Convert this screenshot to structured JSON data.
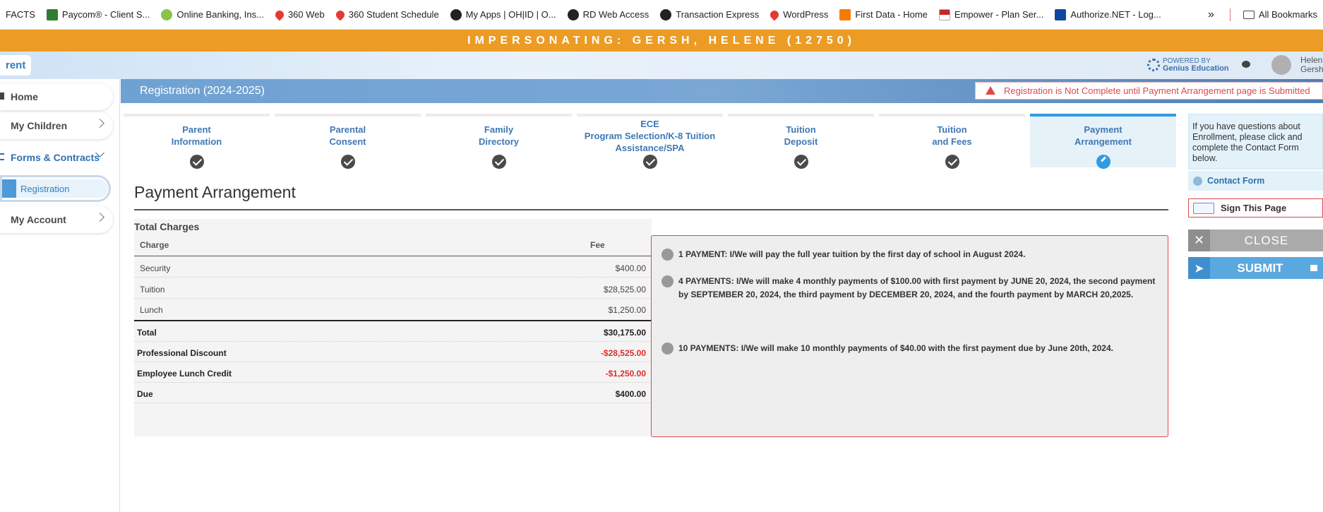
{
  "bookmarks": [
    {
      "label": "FACTS",
      "icon": "none"
    },
    {
      "label": "Paycom® - Client S...",
      "icon": "paycom-icon"
    },
    {
      "label": "Online Banking, Ins...",
      "icon": "bank-icon"
    },
    {
      "label": "360 Web",
      "icon": "drop-icon"
    },
    {
      "label": "360 Student Schedule",
      "icon": "drop-icon"
    },
    {
      "label": "My Apps | OH|ID | O...",
      "icon": "globe-icon"
    },
    {
      "label": "RD Web Access",
      "icon": "globe-icon"
    },
    {
      "label": "Transaction Express",
      "icon": "globe-icon"
    },
    {
      "label": "WordPress",
      "icon": "drop-icon"
    },
    {
      "label": "First Data - Home",
      "icon": "square-icon"
    },
    {
      "label": "Empower - Plan Ser...",
      "icon": "flag-icon"
    },
    {
      "label": "Authorize.NET - Log...",
      "icon": "authorize-icon"
    }
  ],
  "bookmarks_more": "»",
  "all_bookmarks": "All Bookmarks",
  "impersonation": "IMPERSONATING: GERSH, HELENE (12750)",
  "header": {
    "brand": "rent",
    "powered_by": "POWERED BY",
    "powered_name": "Genius Education",
    "user_first": "Helen",
    "user_last": "Gersh"
  },
  "sidebar": {
    "items": [
      {
        "label": "Home"
      },
      {
        "label": "My Children"
      },
      {
        "label": "Forms & Contracts"
      },
      {
        "label": "Registration"
      },
      {
        "label": "My Account"
      }
    ]
  },
  "registration": {
    "title": "Registration (2024-2025)",
    "warning": "Registration is Not Complete until Payment Arrangement page is Submitted"
  },
  "steps": [
    {
      "line1": "Parent",
      "line2": "Information",
      "line3": ""
    },
    {
      "line1": "Parental",
      "line2": "Consent",
      "line3": ""
    },
    {
      "line1": "Family",
      "line2": "Directory",
      "line3": ""
    },
    {
      "line1": "ECE",
      "line2": "Program Selection/K-8 Tuition",
      "line3": "Assistance/SPA"
    },
    {
      "line1": "Tuition",
      "line2": "Deposit",
      "line3": ""
    },
    {
      "line1": "Tuition",
      "line2": "and Fees",
      "line3": ""
    },
    {
      "line1": "Payment",
      "line2": "Arrangement",
      "line3": ""
    }
  ],
  "page": {
    "title": "Payment Arrangement",
    "section": "Total Charges",
    "col_charge": "Charge",
    "col_fee": "Fee"
  },
  "charges": [
    {
      "charge": "Security",
      "fee": "$400.00"
    },
    {
      "charge": "Tuition",
      "fee": "$28,525.00"
    },
    {
      "charge": "Lunch",
      "fee": "$1,250.00"
    }
  ],
  "summary": [
    {
      "label": "Total",
      "value": "$30,175.00"
    },
    {
      "label": "Professional Discount",
      "value": "-$28,525.00"
    },
    {
      "label": "Employee Lunch Credit",
      "value": "-$1,250.00"
    },
    {
      "label": "Due",
      "value": "$400.00"
    }
  ],
  "payment_options": [
    "1 PAYMENT: I/We will pay the full year tuition by the first day of school in August 2024.",
    "4 PAYMENTS: I/We will make 4 monthly payments of $100.00 with first payment by JUNE 20, 2024, the second payment by SEPTEMBER 20, 2024, the third payment by DECEMBER 20, 2024, and the fourth payment by MARCH 20,2025.",
    "10 PAYMENTS: I/We will make 10 monthly payments of $40.00 with the first payment due by June 20th, 2024."
  ],
  "right_panel": {
    "help_text": "If you have questions about Enrollment, please click and complete the Contact Form below.",
    "contact": "Contact Form",
    "sign": "Sign This Page",
    "close": "CLOSE",
    "submit": "SUBMIT"
  },
  "colors": {
    "accent": "#2f7fc1",
    "impersonation_bar": "#ec9c24",
    "warning": "#e0474c"
  }
}
